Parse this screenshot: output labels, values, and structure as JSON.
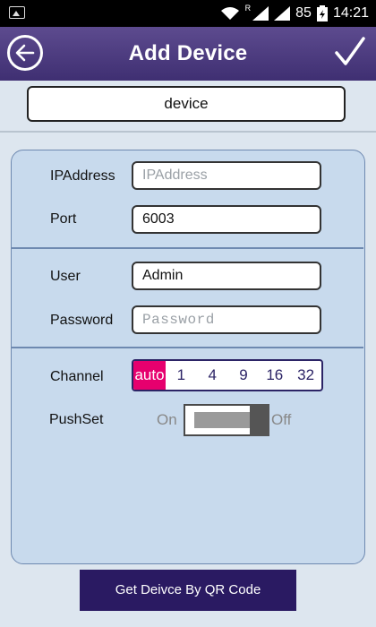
{
  "status_bar": {
    "signal_r": "R",
    "battery": "85",
    "time": "14:21"
  },
  "header": {
    "title": "Add Device",
    "back_icon": "back-arrow-icon",
    "confirm_icon": "checkmark-icon"
  },
  "device": {
    "name": "device"
  },
  "form": {
    "ip": {
      "label": "IPAddress",
      "value": "",
      "placeholder": "IPAddress"
    },
    "port": {
      "label": "Port",
      "value": "6003"
    },
    "user": {
      "label": "User",
      "value": "Admin"
    },
    "password": {
      "label": "Password",
      "value": "",
      "placeholder": "Password"
    },
    "channel": {
      "label": "Channel",
      "options": [
        "auto",
        "1",
        "4",
        "9",
        "16",
        "32"
      ],
      "selected": "auto"
    },
    "pushset": {
      "label": "PushSet",
      "on_label": "On",
      "off_label": "Off",
      "state": "off"
    }
  },
  "actions": {
    "qr_button": "Get Deivce By QR Code"
  },
  "colors": {
    "header": "#4a3a80",
    "accent": "#e6006e",
    "button": "#2a1a62",
    "panel": "#c8daed"
  }
}
